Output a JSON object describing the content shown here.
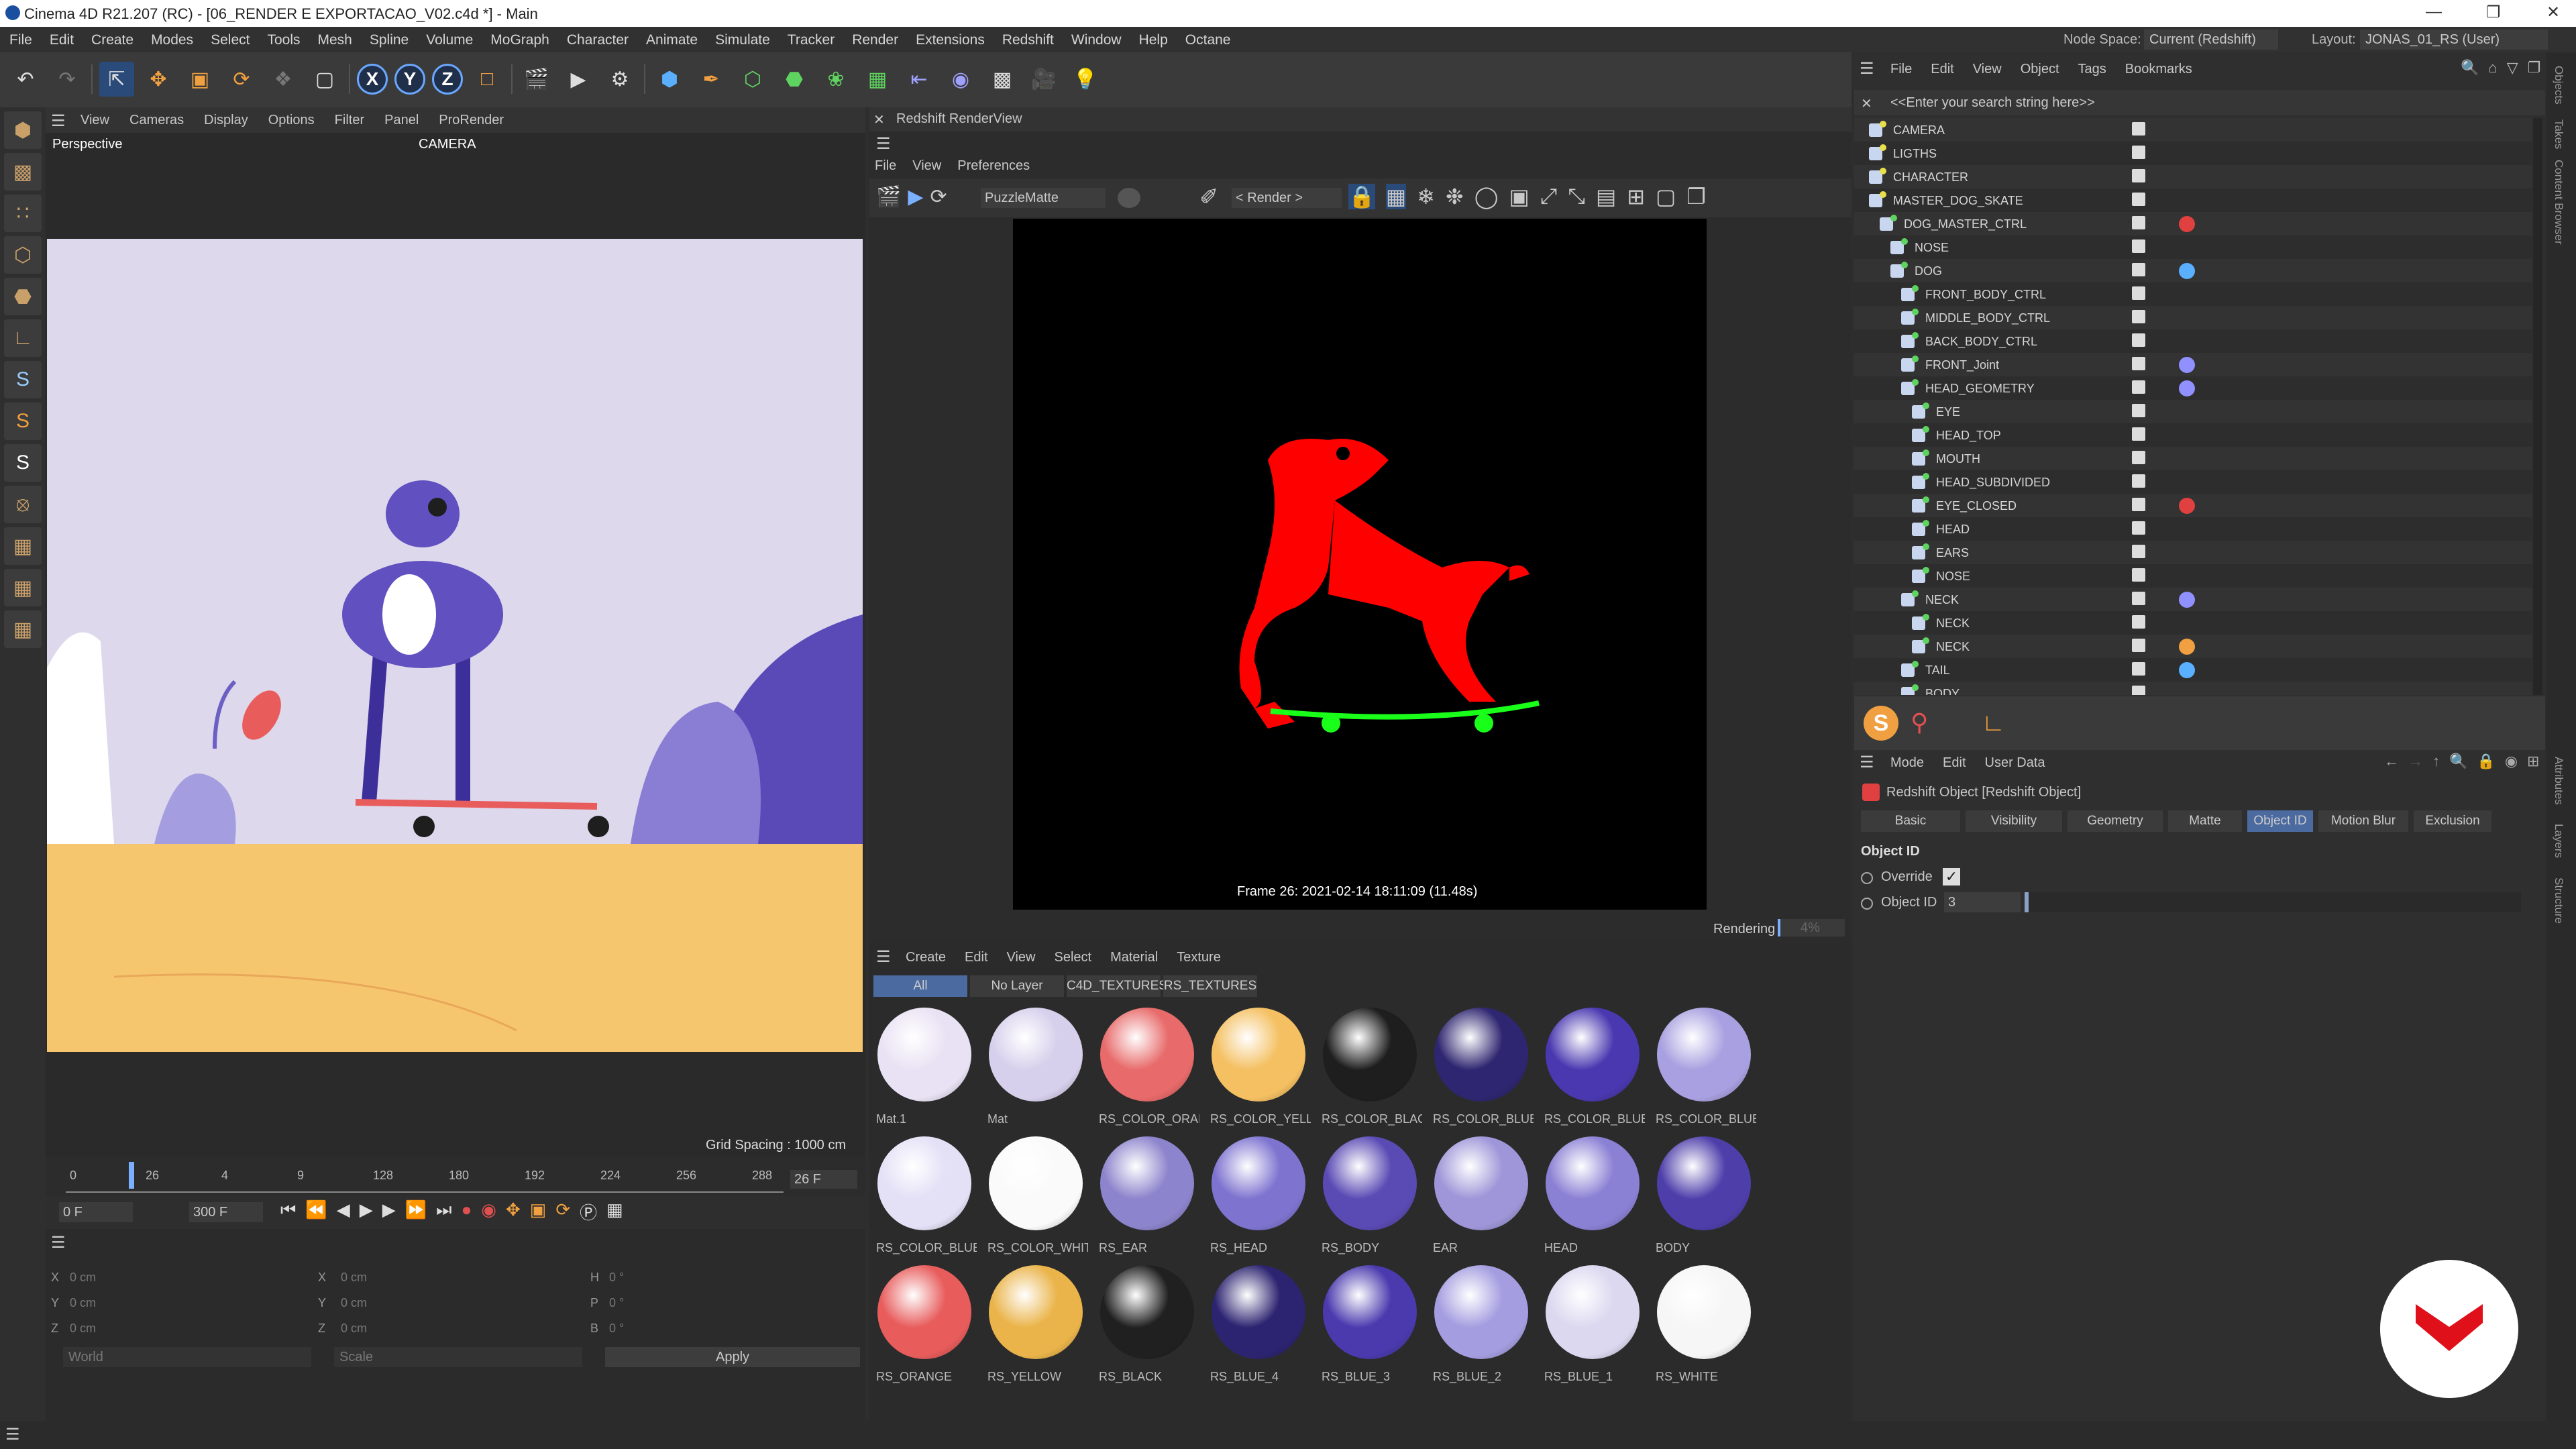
{
  "app": {
    "title": "Cinema 4D R21.207 (RC) - [06_RENDER E EXPORTACAO_V02.c4d *] - Main"
  },
  "menu": [
    "File",
    "Edit",
    "Create",
    "Modes",
    "Select",
    "Tools",
    "Mesh",
    "Spline",
    "Volume",
    "MoGraph",
    "Character",
    "Animate",
    "Simulate",
    "Tracker",
    "Render",
    "Extensions",
    "Redshift",
    "Window",
    "Help",
    "Octane"
  ],
  "top_right": {
    "node_space_label": "Node Space:",
    "node_space_value": "Current (Redshift)",
    "layout_label": "Layout:",
    "layout_value": "JONAS_01_RS (User)"
  },
  "viewport": {
    "menu": [
      "View",
      "Cameras",
      "Display",
      "Options",
      "Filter",
      "Panel",
      "ProRender"
    ],
    "name": "Perspective",
    "camera": "CAMERA",
    "grid": "Grid Spacing : 1000 cm"
  },
  "timeline": {
    "ticks": [
      "0",
      "26",
      "4",
      "9",
      "128",
      "180",
      "192",
      "224",
      "256",
      "288"
    ],
    "current_frame": "26 F",
    "start": "0 F",
    "end": "300 F"
  },
  "coords": {
    "x1": "X",
    "y1": "Y",
    "z1": "Z",
    "x2": "X",
    "y2": "Y",
    "z2": "Z",
    "h": "H",
    "p": "P",
    "b": "B",
    "v_cm": "0 cm",
    "v_deg": "0 °",
    "world": "World",
    "scale": "Scale",
    "apply": "Apply"
  },
  "renderview": {
    "title": "Redshift RenderView",
    "menu": [
      "File",
      "View",
      "Preferences"
    ],
    "aov": "PuzzleMatte",
    "render_sel": "< Render >",
    "frame_info": "Frame  26:  2021-02-14  18:11:09  (11.48s)",
    "status": "Rendering",
    "progress": "4%"
  },
  "materials": {
    "menu": [
      "Create",
      "Edit",
      "View",
      "Select",
      "Material",
      "Texture"
    ],
    "tabs": [
      "All",
      "No Layer",
      "C4D_TEXTURES",
      "RS_TEXTURES"
    ],
    "items": [
      {
        "label": "Mat.1",
        "color": "#e9e2f4"
      },
      {
        "label": "Mat",
        "color": "#d7d0ec"
      },
      {
        "label": "RS_COLOR_ORAN",
        "color": "#e86a6a"
      },
      {
        "label": "RS_COLOR_YELLO",
        "color": "#f4c062"
      },
      {
        "label": "RS_COLOR_BLACK",
        "color": "#1e1e1e"
      },
      {
        "label": "RS_COLOR_BLUE_",
        "color": "#2e2670"
      },
      {
        "label": "RS_COLOR_BLUE_",
        "color": "#4a38b0"
      },
      {
        "label": "RS_COLOR_BLUE_",
        "color": "#a8a0e0"
      },
      {
        "label": "RS_COLOR_BLUE_",
        "color": "#e4e0f6"
      },
      {
        "label": "RS_COLOR_WHITE",
        "color": "#fafafa"
      },
      {
        "label": "RS_EAR",
        "color": "#8c84cc"
      },
      {
        "label": "RS_HEAD",
        "color": "#7e74d0"
      },
      {
        "label": "RS_BODY",
        "color": "#5a4ab4"
      },
      {
        "label": "EAR",
        "color": "#9e96d8"
      },
      {
        "label": "HEAD",
        "color": "#8a80d4"
      },
      {
        "label": "BODY",
        "color": "#4e3eaa"
      },
      {
        "label": "RS_ORANGE",
        "color": "#e85c5c"
      },
      {
        "label": "RS_YELLOW",
        "color": "#eab44a"
      },
      {
        "label": "RS_BLACK",
        "color": "#202020"
      },
      {
        "label": "RS_BLUE_4",
        "color": "#2c2470"
      },
      {
        "label": "RS_BLUE_3",
        "color": "#4a3aae"
      },
      {
        "label": "RS_BLUE_2",
        "color": "#a49ee0"
      },
      {
        "label": "RS_BLUE_1",
        "color": "#dcd8f0"
      },
      {
        "label": "RS_WHITE",
        "color": "#f6f6f6"
      }
    ]
  },
  "objects": {
    "menu": [
      "File",
      "Edit",
      "View",
      "Object",
      "Tags",
      "Bookmarks"
    ],
    "search": "<<Enter your search string here>>",
    "rows": [
      "CAMERA",
      "LIGTHS",
      "CHARACTER",
      "MASTER_DOG_SKATE",
      "DOG_MASTER_CTRL",
      "NOSE",
      "DOG",
      "FRONT_BODY_CTRL",
      "MIDDLE_BODY_CTRL",
      "BACK_BODY_CTRL",
      "FRONT_Joint",
      "HEAD_GEOMETRY",
      "EYE",
      "HEAD_TOP",
      "MOUTH",
      "HEAD_SUBDIVIDED",
      "EYE_CLOSED",
      "HEAD",
      "EARS",
      "NOSE",
      "NECK",
      "NECK",
      "NECK",
      "TAIL",
      "BODY"
    ]
  },
  "attributes": {
    "menu": [
      "Mode",
      "Edit",
      "User Data"
    ],
    "object": "Redshift Object [Redshift Object]",
    "tabs": [
      "Basic",
      "Visibility",
      "Geometry",
      "Matte",
      "Object ID",
      "Motion Blur",
      "Exclusion"
    ],
    "section": "Object ID",
    "override": "Override",
    "objid_label": "Object ID",
    "objid_value": "3"
  },
  "side_tabs": [
    "Objects",
    "Takes",
    "Content Browser",
    "Attributes",
    "Layers",
    "Structure"
  ]
}
